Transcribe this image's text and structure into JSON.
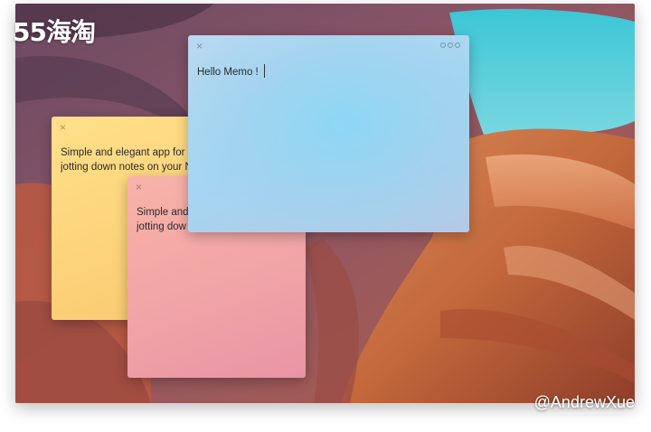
{
  "watermarks": {
    "top_left": "55海淘",
    "bottom_right": "@AndrewXue"
  },
  "notes": [
    {
      "id": "yellow",
      "color": "#fcd27a",
      "close_icon": "close-icon",
      "text": "Simple and elegant app for c\njotting down notes on your N"
    },
    {
      "id": "pink",
      "color": "#f1a4a6",
      "close_icon": "close-icon",
      "text": "Simple and\njotting dow"
    },
    {
      "id": "blue",
      "color": "#a6d6f2",
      "close_icon": "close-icon",
      "menu_icon": "more-dots-icon",
      "text": "Hello Memo !"
    }
  ],
  "icons": {
    "close": "×"
  }
}
